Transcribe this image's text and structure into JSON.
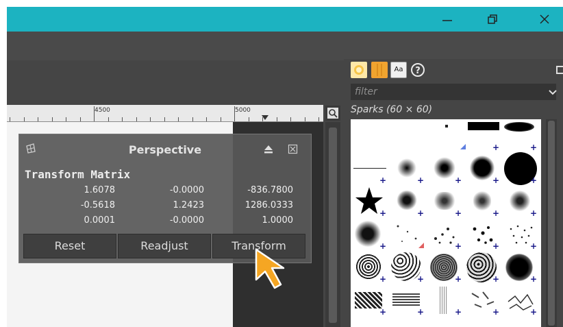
{
  "window": {
    "accent": "#1cb3c1",
    "controls": [
      "minimize-icon",
      "restore-icon",
      "close-icon"
    ]
  },
  "ruler": {
    "labels": [
      "4500",
      "5000"
    ]
  },
  "dock": {
    "tab_icons": [
      "brushes-tab-icon",
      "patterns-tab-icon",
      "fonts-tab-icon",
      "help-tab-icon"
    ],
    "fonts_tab_label": "Aa",
    "filter_placeholder": "filter",
    "brush_name": "Sparks (60 × 60)"
  },
  "perspective": {
    "title": "Perspective",
    "section_title": "Transform Matrix",
    "matrix": [
      [
        "1.6078",
        "-0.0000",
        "-836.7800"
      ],
      [
        "-0.5618",
        "1.2423",
        "1286.0333"
      ],
      [
        "0.0001",
        "-0.0000",
        "1.0000"
      ]
    ],
    "buttons": {
      "reset": "Reset",
      "readjust": "Readjust",
      "transform": "Transform"
    },
    "accent_cursor": "#f5a623"
  }
}
